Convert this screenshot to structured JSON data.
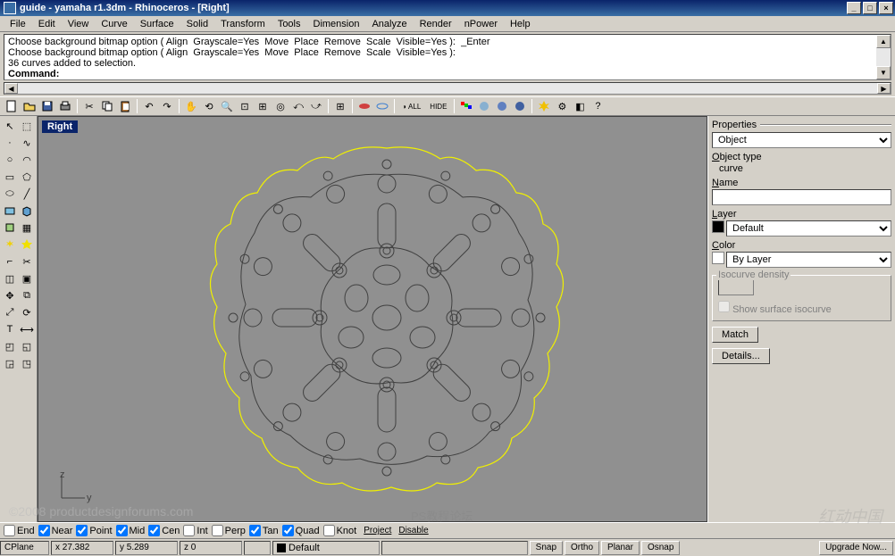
{
  "title": "guide - yamaha r1.3dm - Rhinoceros - [Right]",
  "menus": [
    "File",
    "Edit",
    "View",
    "Curve",
    "Surface",
    "Solid",
    "Transform",
    "Tools",
    "Dimension",
    "Analyze",
    "Render",
    "nPower",
    "Help"
  ],
  "cmd_lines": "Choose background bitmap option ( Align  Grayscale=Yes  Move  Place  Remove  Scale  Visible=Yes ):  _Enter\nChoose background bitmap option ( Align  Grayscale=Yes  Move  Place  Remove  Scale  Visible=Yes ):\n36 curves added to selection.",
  "cmd_prompt": "Command:",
  "viewport_label": "Right",
  "axis_z": "z",
  "axis_y": "y",
  "properties": {
    "header": "Properties",
    "selector": "Object",
    "object_type_label": "Object type",
    "object_type": "curve",
    "name_label": "Name",
    "name": "",
    "layer_label": "Layer",
    "layer": "Default",
    "color_label": "Color",
    "color": "By Layer",
    "iso_group": "Isocurve density",
    "iso_show": "Show surface isocurve",
    "btn_match": "Match",
    "btn_details": "Details..."
  },
  "osnap": {
    "end": "End",
    "near": "Near",
    "point": "Point",
    "mid": "Mid",
    "cen": "Cen",
    "int": "Int",
    "perp": "Perp",
    "tan": "Tan",
    "quad": "Quad",
    "knot": "Knot",
    "project": "Project",
    "disable": "Disable"
  },
  "status": {
    "cplane": "CPlane",
    "x": "x 27.382",
    "y": "y 5.289",
    "z": "z 0",
    "layer": "Default",
    "layer_swatch": "#000",
    "snap": "Snap",
    "ortho": "Ortho",
    "planar": "Planar",
    "osnap": "Osnap",
    "upgrade": "Upgrade Now..."
  },
  "watermark": "©2008 productdesignforums.com",
  "watermark_center": "PS教程论坛"
}
